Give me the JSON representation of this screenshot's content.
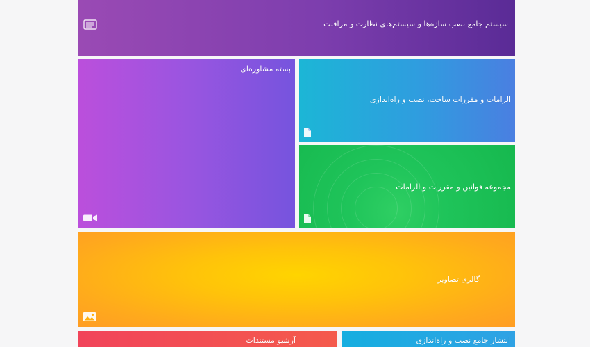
{
  "tiles": {
    "header": {
      "title": "سیستم جامع نصب سازه‌ها و سیستم‌های نظارت و مراقبت",
      "icon": "document-icon"
    },
    "purple": {
      "title": "بسته مشاوره‌ای",
      "icon": "video-icon"
    },
    "blue": {
      "title": "الزامات و مقررات ساخت، نصب و راه‌اندازی",
      "icon": "doc-icon"
    },
    "green": {
      "title": "مجموعه قوانین و مقررات و الزامات",
      "icon": "doc-icon"
    },
    "orange": {
      "title": "گالری تصاویر",
      "icon": "image-icon"
    },
    "red": {
      "title": "آرشیو مستندات"
    },
    "teal": {
      "title": "انتشار جامع نصب و راه‌اندازی"
    }
  },
  "colors": {
    "header": "#7d3eae",
    "purple": "#9a55e0",
    "blue": "#2f9ddf",
    "green": "#1fc45a",
    "orange": "#ffc30a",
    "red": "#f1445a",
    "teal": "#16aee0"
  }
}
